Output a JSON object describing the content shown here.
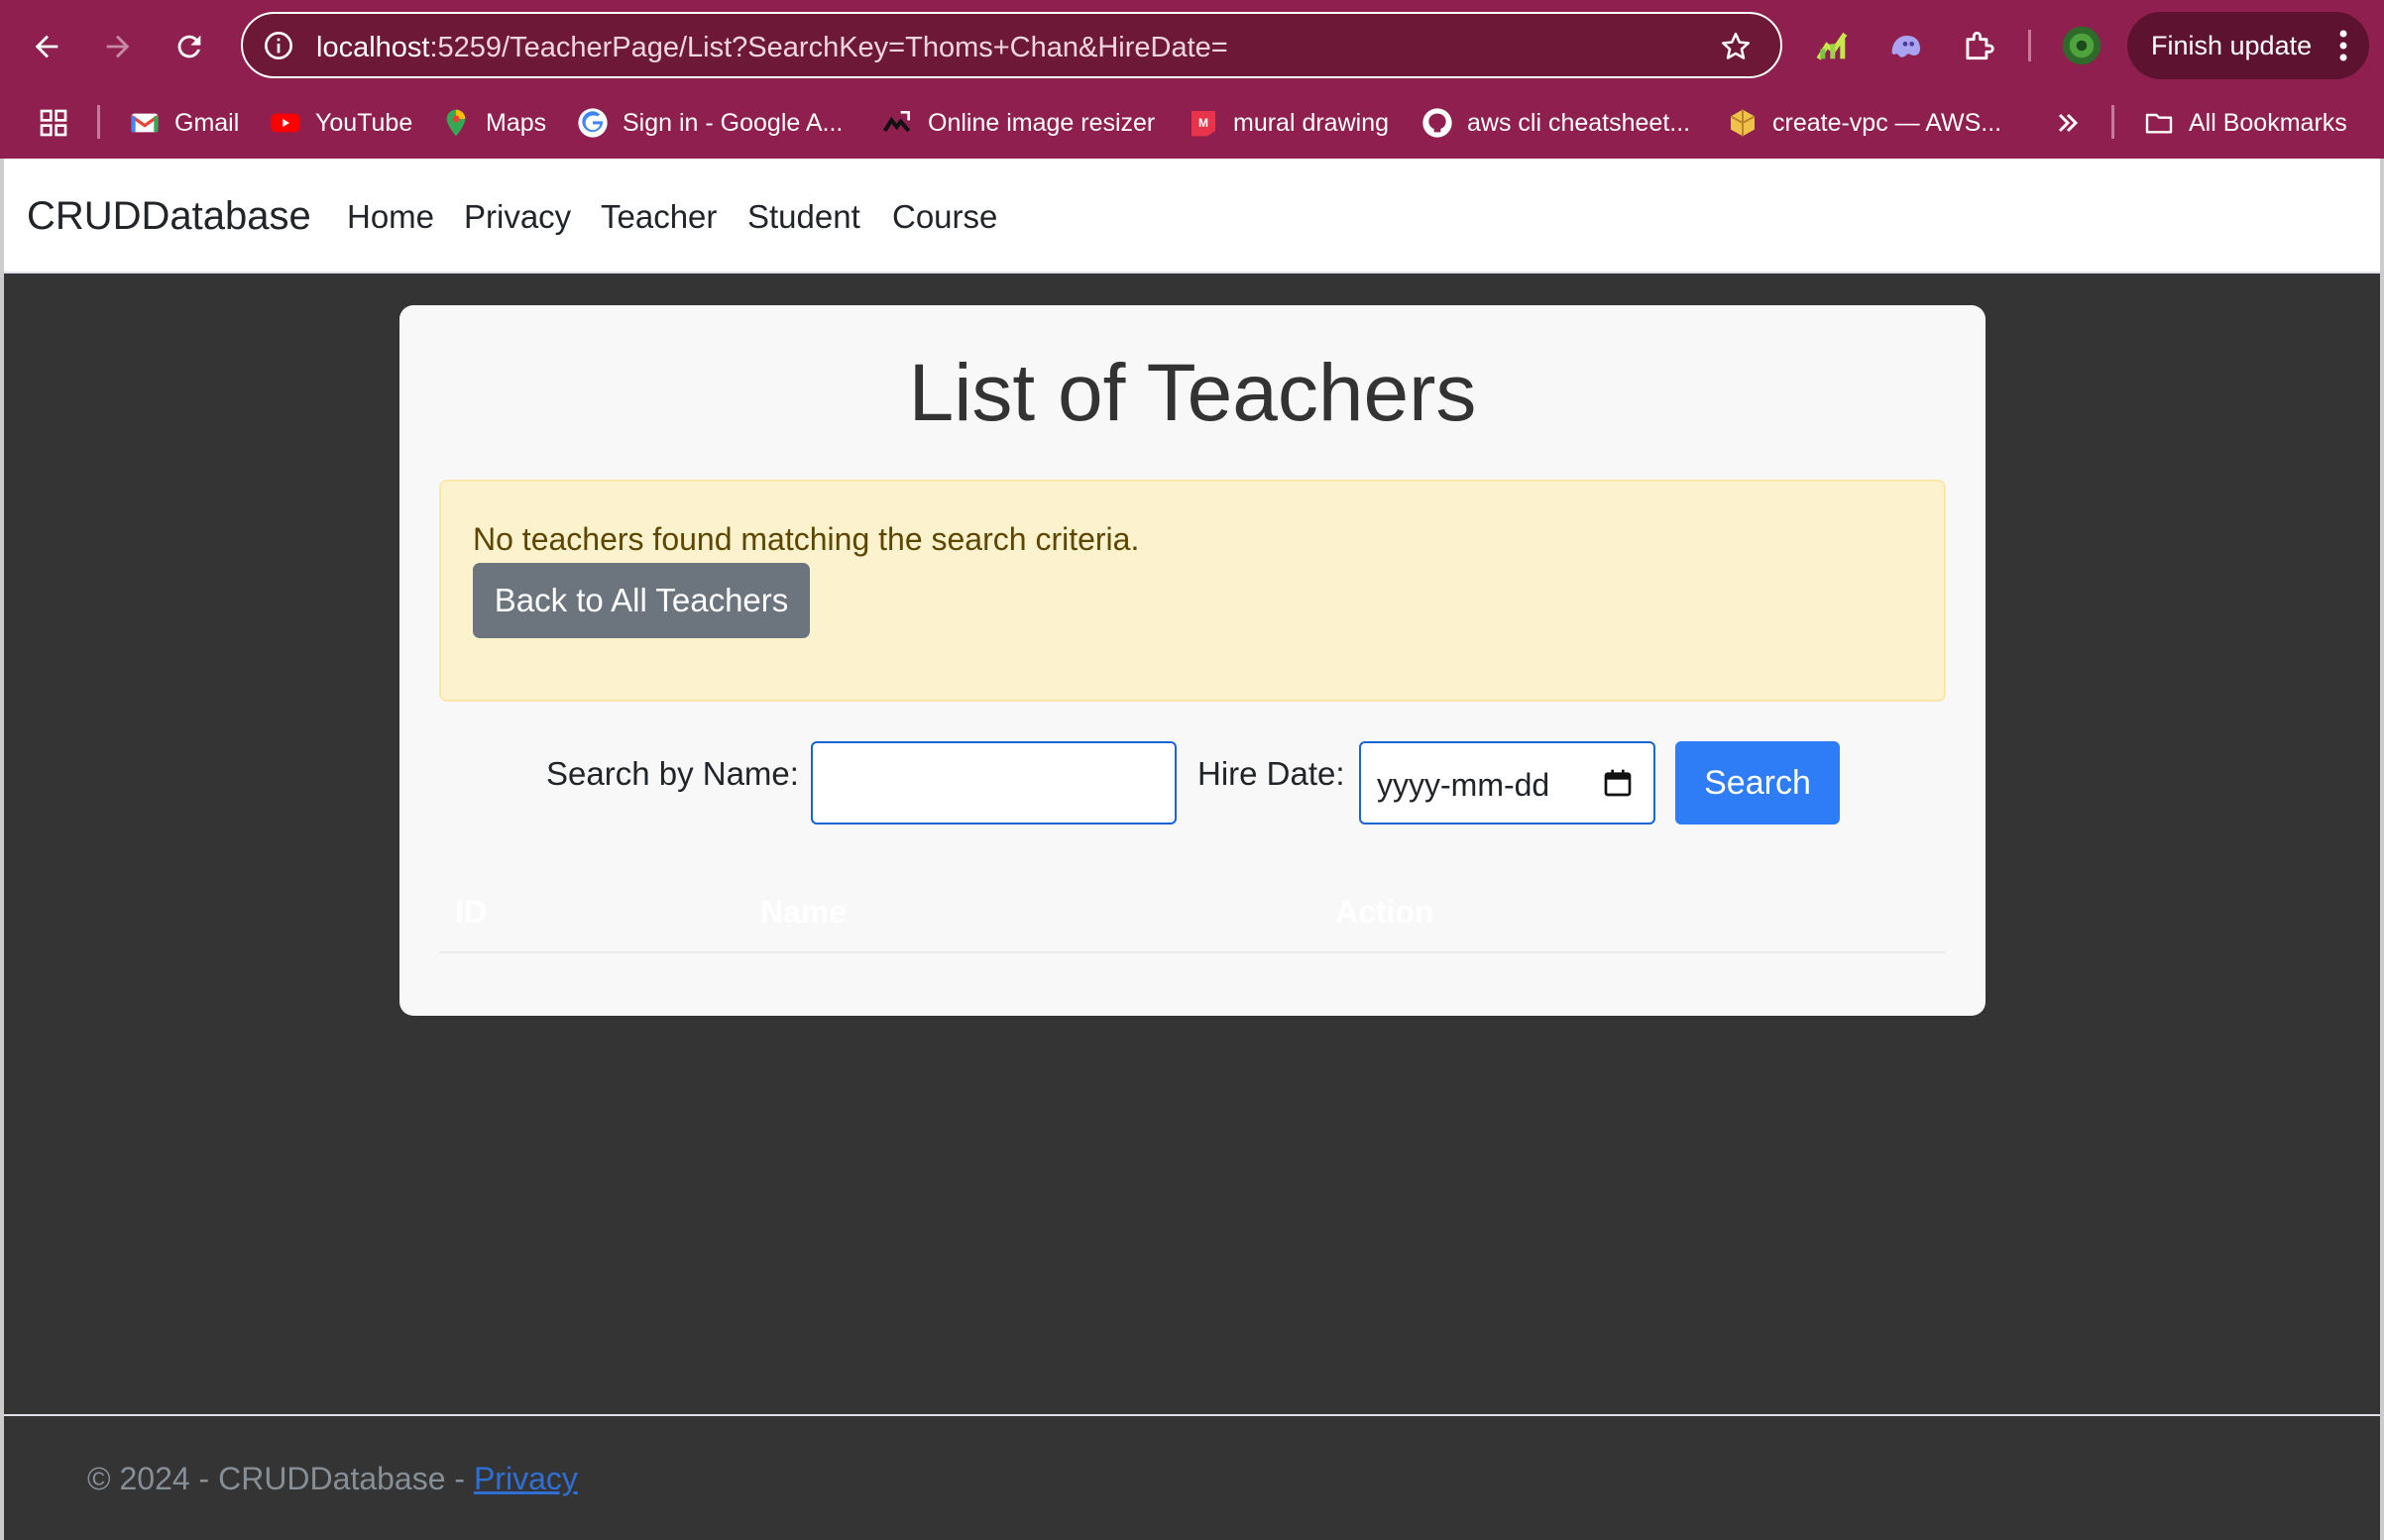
{
  "browser": {
    "url_host": "localhost",
    "url_rest": ":5259/TeacherPage/List?SearchKey=Thoms+Chan&HireDate=",
    "finish_update": "Finish update",
    "bookmarks": [
      {
        "label": "Gmail",
        "icon": "gmail-icon"
      },
      {
        "label": "YouTube",
        "icon": "youtube-icon"
      },
      {
        "label": "Maps",
        "icon": "maps-icon"
      },
      {
        "label": "Sign in - Google A...",
        "icon": "google-icon"
      },
      {
        "label": "Online image resizer",
        "icon": "resizer-icon"
      },
      {
        "label": "mural drawing",
        "icon": "mural-icon"
      },
      {
        "label": "aws cli cheatsheet...",
        "icon": "github-icon"
      },
      {
        "label": "create-vpc — AWS...",
        "icon": "aws-icon"
      }
    ],
    "all_bookmarks": "All Bookmarks",
    "colors": {
      "chrome": "#8e1f4f",
      "omnibox": "#6e1838"
    }
  },
  "navbar": {
    "brand": "CRUDDatabase",
    "links": [
      "Home",
      "Privacy",
      "Teacher",
      "Student",
      "Course"
    ]
  },
  "main": {
    "title": "List of Teachers",
    "alert_text": "No teachers found matching the search criteria.",
    "back_button": "Back to All Teachers",
    "search_label": "Search by Name:",
    "search_value": "",
    "hire_date_label": "Hire Date:",
    "hire_date_placeholder": "yyyy-mm-dd",
    "search_button": "Search",
    "table_headers": [
      "ID",
      "Name",
      "Action"
    ]
  },
  "footer": {
    "text": "© 2024 - CRUDDatabase - ",
    "privacy_link": "Privacy"
  }
}
